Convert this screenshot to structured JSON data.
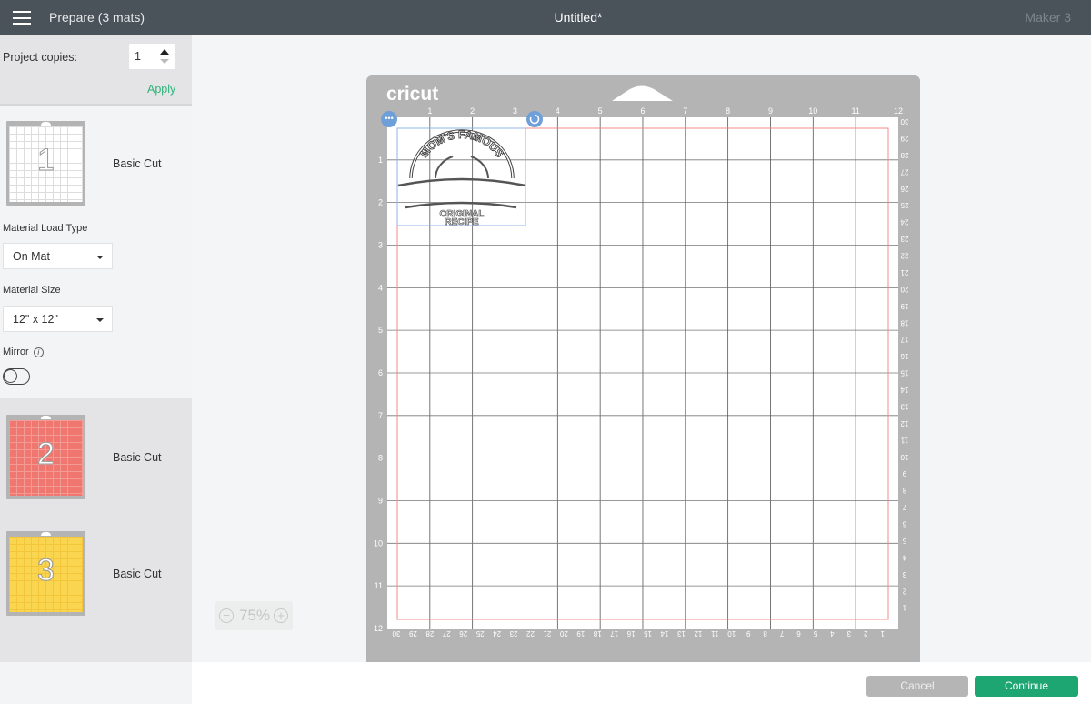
{
  "topbar": {
    "title": "Prepare (3 mats)",
    "document": "Untitled*",
    "machine": "Maker 3"
  },
  "copies": {
    "label": "Project copies:",
    "value": "1",
    "apply": "Apply"
  },
  "mats": [
    {
      "number": "1",
      "label": "Basic Cut",
      "color": "#ffffff"
    },
    {
      "number": "2",
      "label": "Basic Cut",
      "color": "#f07670"
    },
    {
      "number": "3",
      "label": "Basic Cut",
      "color": "#fad54f"
    }
  ],
  "settings": {
    "load_type_label": "Material Load Type",
    "load_type": "On Mat",
    "size_label": "Material Size",
    "size": "12\" x 12\"",
    "mirror_label": "Mirror",
    "mirror_on": false
  },
  "zoom": {
    "value": "75%",
    "minus": "−",
    "plus": "+"
  },
  "canvas": {
    "brand": "cricut",
    "top_ruler": [
      "1",
      "2",
      "3",
      "4",
      "5",
      "6",
      "7",
      "8",
      "9",
      "10",
      "11",
      "12"
    ],
    "left_ruler": [
      "1",
      "2",
      "3",
      "4",
      "5",
      "6",
      "7",
      "8",
      "9",
      "10",
      "11",
      "12"
    ],
    "cm_ruler": [
      "30",
      "29",
      "28",
      "27",
      "26",
      "25",
      "24",
      "23",
      "22",
      "21",
      "20",
      "19",
      "18",
      "17",
      "16",
      "15",
      "14",
      "13",
      "12",
      "11",
      "10",
      "9",
      "8",
      "7",
      "6",
      "5",
      "4",
      "3",
      "2",
      "1"
    ],
    "design": {
      "line1": "MOM'S FAMOUS",
      "line2": "ORIGINAL",
      "line3": "RECIPE"
    },
    "colors": {
      "mat": "#b4b4b4",
      "cut_area": "#f08a8a",
      "selection": "#6f9fd8"
    }
  },
  "footer": {
    "cancel": "Cancel",
    "continue": "Continue"
  }
}
